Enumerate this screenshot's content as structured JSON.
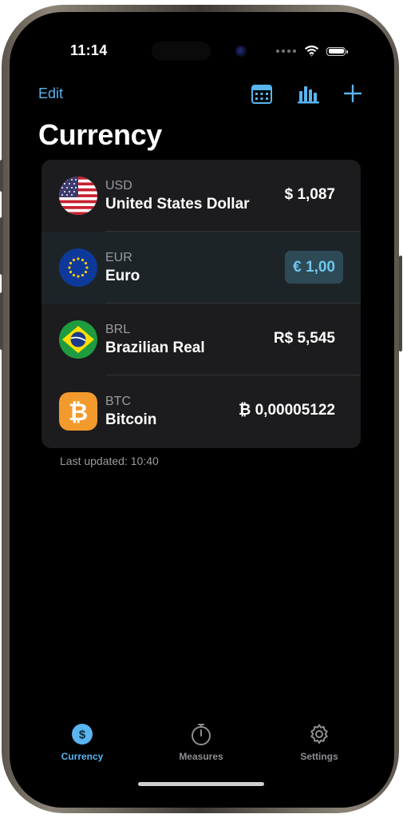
{
  "status_bar": {
    "time": "11:14"
  },
  "nav": {
    "edit_label": "Edit",
    "actions": [
      "calculator-icon",
      "chart-bars-icon",
      "plus-icon"
    ]
  },
  "page": {
    "title": "Currency"
  },
  "currencies": [
    {
      "code": "USD",
      "name": "United States Dollar",
      "value": "$ 1,087",
      "flag": "us-flag-icon",
      "selected": false
    },
    {
      "code": "EUR",
      "name": "Euro",
      "value": "€ 1,00",
      "flag": "eu-flag-icon",
      "selected": true
    },
    {
      "code": "BRL",
      "name": "Brazilian Real",
      "value": "R$ 5,545",
      "flag": "br-flag-icon",
      "selected": false
    },
    {
      "code": "BTC",
      "name": "Bitcoin",
      "value": "₿ 0,00005122",
      "flag": "bitcoin-icon",
      "selected": false
    }
  ],
  "footer": {
    "last_updated": "Last updated: 10:40"
  },
  "tabs": [
    {
      "label": "Currency",
      "icon": "dollar-circle-icon",
      "active": true
    },
    {
      "label": "Measures",
      "icon": "stopwatch-icon",
      "active": false
    },
    {
      "label": "Settings",
      "icon": "gear-icon",
      "active": false
    }
  ],
  "colors": {
    "accent": "#5ab4f0",
    "background": "#000000",
    "card": "#1c1c1e",
    "selected_value_bg": "#2e4a56",
    "inactive_tab": "#8e8e93"
  }
}
